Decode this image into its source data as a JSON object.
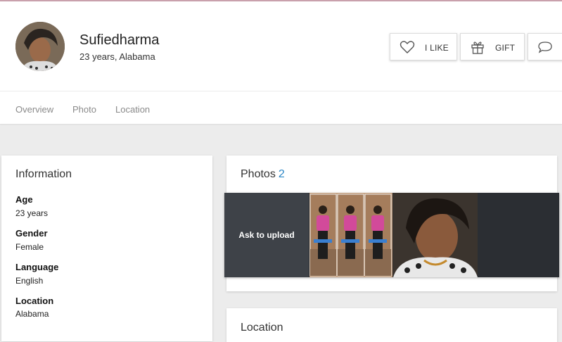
{
  "profile": {
    "name": "Sufiedharma",
    "subtitle": "23 years, Alabama"
  },
  "actions": {
    "like_label": "I LIKE",
    "gift_label": "GIFT"
  },
  "tabs": [
    {
      "label": "Overview"
    },
    {
      "label": "Photo"
    },
    {
      "label": "Location"
    }
  ],
  "information": {
    "title": "Information",
    "fields": [
      {
        "label": "Age",
        "value": "23 years"
      },
      {
        "label": "Gender",
        "value": "Female"
      },
      {
        "label": "Language",
        "value": "English"
      },
      {
        "label": "Location",
        "value": "Alabama"
      }
    ]
  },
  "photos": {
    "title": "Photos",
    "count": "2",
    "ask_label": "Ask to upload"
  },
  "location_section": {
    "title": "Location"
  },
  "colors": {
    "count_accent": "#2b86c5",
    "strip_bg": "#2b2e33",
    "ask_bg": "#3e4248"
  }
}
